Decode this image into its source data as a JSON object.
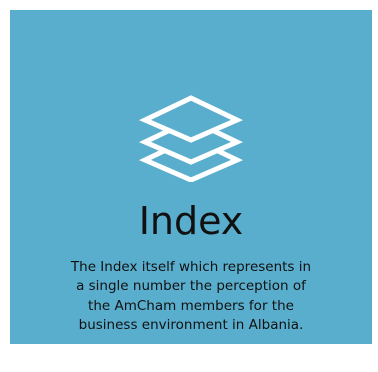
{
  "card": {
    "background_color": "#5aaecd",
    "icon": "layers-icon",
    "icon_color": "#ffffff",
    "title": "Index",
    "description": "The Index itself which represents in a single number the perception of the AmCham members for the business environment in Albania."
  }
}
